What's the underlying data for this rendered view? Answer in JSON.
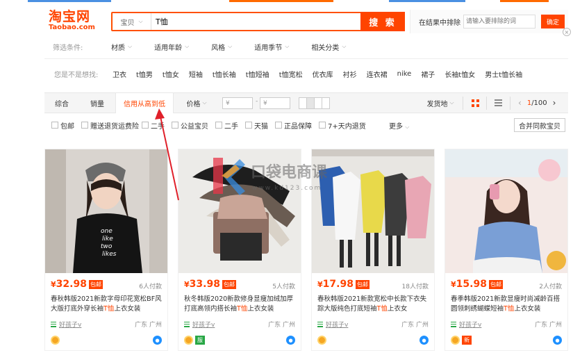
{
  "colors": {
    "accent": "#ff4400",
    "link_green": "#28a745",
    "wangwang": "#1e90ff"
  },
  "logo": {
    "cn": "淘宝网",
    "en": "Taobao.com"
  },
  "search": {
    "category": "宝贝",
    "query": "T恤",
    "button": "搜 索",
    "camera_icon": "camera-icon"
  },
  "exclude": {
    "label": "在结果中排除",
    "placeholder": "请输入要排除的词",
    "confirm": "确定"
  },
  "filters": {
    "label": "筛选条件:",
    "items": [
      "材质",
      "适用年龄",
      "风格",
      "适用季节",
      "相关分类"
    ]
  },
  "suggest": {
    "label": "您是不是想找:",
    "items": [
      "卫衣",
      "t恤男",
      "t恤女",
      "短袖",
      "t恤长袖",
      "t恤短袖",
      "t恤宽松",
      "优衣库",
      "衬衫",
      "连衣裙",
      "nike",
      "裙子",
      "长袖t恤女",
      "男士t恤长袖"
    ]
  },
  "sortbar": {
    "tabs": [
      "综合",
      "销量",
      "信用从高到低",
      "价格"
    ],
    "price_from": "¥",
    "price_to": "¥",
    "dash": "-",
    "ship_from": "发货地",
    "page_current": "1",
    "page_total": "/100"
  },
  "checks": {
    "items": [
      "包邮",
      "赠送退货运费险",
      "二手",
      "公益宝贝",
      "二手",
      "天猫",
      "正品保障",
      "7+天内退货"
    ],
    "more": "更多",
    "merge": "合并同款宝贝"
  },
  "products": [
    {
      "yen": "¥",
      "price": "32.98",
      "tag": "包邮",
      "sales": "6人付款",
      "title_pre": "春秋韩版2021新款字母印花宽松BF风大版打底外穿长袖",
      "title_hl": "T恤",
      "title_post": "上衣女装",
      "shop": "好孩子v",
      "location": "广东 广州",
      "badge2": ""
    },
    {
      "yen": "¥",
      "price": "33.98",
      "tag": "包邮",
      "sales": "5人付款",
      "title_pre": "秋冬韩版2020新款修身显瘦加绒加厚打底高领内搭长袖",
      "title_hl": "T恤",
      "title_post": "上衣女装",
      "shop": "好孩子v",
      "location": "广东 广州",
      "badge2": "服"
    },
    {
      "yen": "¥",
      "price": "17.98",
      "tag": "包邮",
      "sales": "18人付款",
      "title_pre": "春秋韩版2021新款宽松中长款下衣失踪大版纯色打底短袖",
      "title_hl": "T恤",
      "title_post": "上衣女",
      "shop": "好孩子v",
      "location": "广东 广州",
      "badge2": ""
    },
    {
      "yen": "¥",
      "price": "15.98",
      "tag": "包邮",
      "sales": "2人付款",
      "title_pre": "春季韩版2021新款显瘦时尚减龄百搭圆领刺绣蝴蝶短袖",
      "title_hl": "T恤",
      "title_post": "上衣女装",
      "shop": "好孩子v",
      "location": "广东 广州",
      "badge2": "新"
    }
  ],
  "watermark": {
    "text": "口袋电商课",
    "url": "www.kd123.com"
  }
}
